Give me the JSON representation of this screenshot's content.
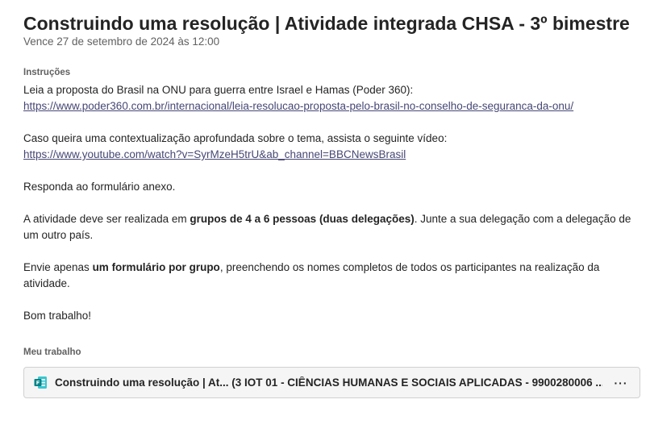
{
  "assignment": {
    "title": "Construindo uma resolução | Atividade integrada CHSA - 3º bimestre",
    "due": "Vence 27 de setembro de 2024 às 12:00"
  },
  "instructions": {
    "label": "Instruções",
    "p1_text": "Leia a proposta do Brasil na ONU para guerra entre Israel e Hamas (Poder 360):",
    "p1_link": "https://www.poder360.com.br/internacional/leia-resolucao-proposta-pelo-brasil-no-conselho-de-seguranca-da-onu/",
    "p2_text": "Caso queira uma contextualização aprofundada sobre o tema, assista o seguinte vídeo:",
    "p2_link": "https://www.youtube.com/watch?v=SyrMzeH5trU&ab_channel=BBCNewsBrasil",
    "p3_text": "Responda ao formulário anexo.",
    "p4_before": "A atividade deve ser realizada em ",
    "p4_bold": "grupos de 4 a 6 pessoas (duas delegações)",
    "p4_after": ". Junte a sua delegação com a delegação de um outro país.",
    "p5_before": "Envie apenas ",
    "p5_bold": "um formulário por grupo",
    "p5_after": ", preenchendo os nomes completos de todos os participantes na realização da atividade.",
    "p6_text": "Bom trabalho!"
  },
  "my_work": {
    "label": "Meu trabalho",
    "attachment_name": "Construindo uma resolução | At... (3 IOT 01 - CIÊNCIAS HUMANAS E SOCIAIS APLICADAS - 9900280006 ...)",
    "attachment_icon": "microsoft-forms-icon",
    "more_label": "···"
  },
  "colors": {
    "link": "#464775",
    "forms_brand": "#038387"
  }
}
